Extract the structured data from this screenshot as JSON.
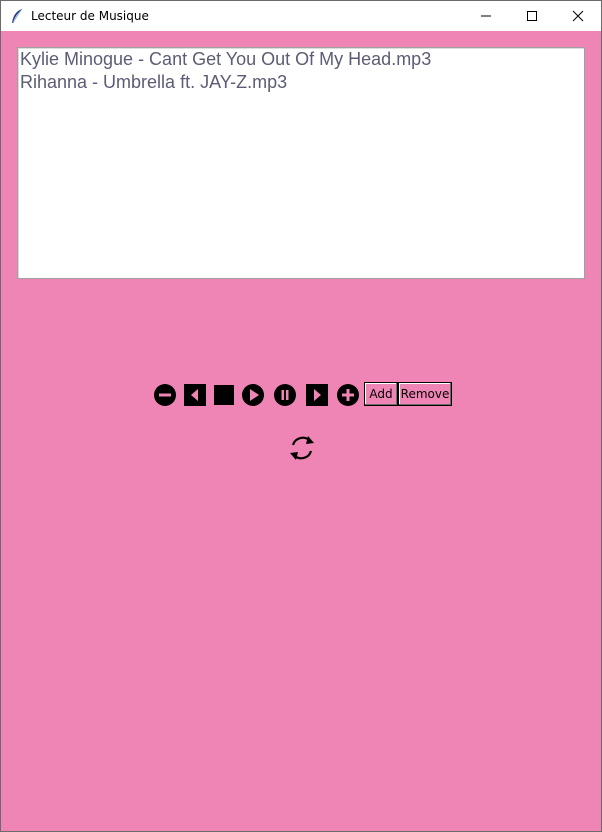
{
  "window": {
    "title": "Lecteur de Musique",
    "background": "#ef85b4"
  },
  "titlebar_buttons": [
    "minimize-icon",
    "maximize-icon",
    "close-icon"
  ],
  "playlist": {
    "items": [
      "Kylie Minogue - Cant Get You Out Of My Head.mp3",
      "Rihanna - Umbrella ft. JAY-Z.mp3"
    ]
  },
  "controls": {
    "icons": [
      "volume-down-icon",
      "previous-icon",
      "stop-icon",
      "play-icon",
      "pause-icon",
      "next-icon",
      "volume-up-icon"
    ],
    "add_label": "Add",
    "remove_label": "Remove",
    "repeat_icon": "repeat-icon"
  }
}
